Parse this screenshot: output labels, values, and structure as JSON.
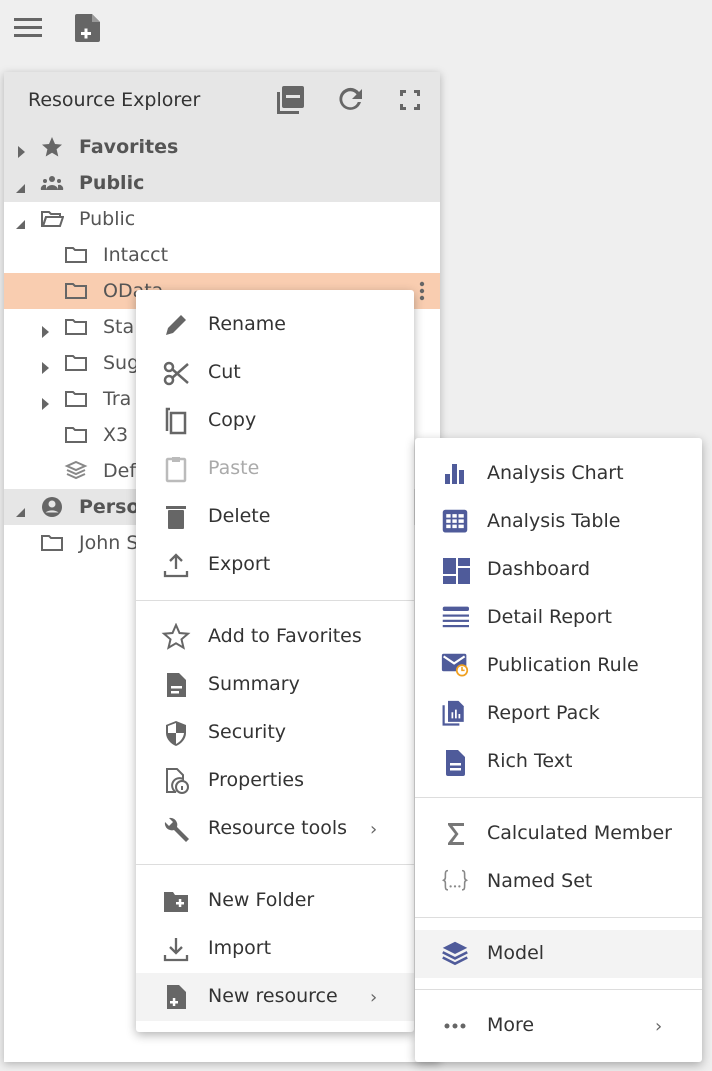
{
  "toolbar": {
    "menu_icon": "hamburger-icon",
    "new_resource_icon": "file-plus-icon"
  },
  "explorer": {
    "title": "Resource Explorer",
    "header_icons": [
      "collapse-all-icon",
      "refresh-icon",
      "fullscreen-icon"
    ],
    "tree": [
      {
        "label": "Favorites",
        "icon": "star-icon",
        "expander": "collapsed"
      },
      {
        "label": "Public",
        "icon": "group-icon",
        "expander": "expanded"
      },
      {
        "label": "Public",
        "icon": "folder-open-icon",
        "expander": "expanded"
      },
      {
        "label": "Intacct",
        "icon": "folder-icon"
      },
      {
        "label": "OData",
        "icon": "folder-icon",
        "selected": true
      },
      {
        "label": "Sta",
        "icon": "folder-icon",
        "expander": "collapsed"
      },
      {
        "label": "Sug",
        "icon": "folder-icon",
        "expander": "collapsed"
      },
      {
        "label": "Tra",
        "icon": "folder-icon",
        "expander": "collapsed"
      },
      {
        "label": "X3",
        "icon": "folder-icon"
      },
      {
        "label": "Def",
        "icon": "model-icon"
      },
      {
        "label": "Perso",
        "icon": "account-icon",
        "expander": "expanded"
      },
      {
        "label": "John S",
        "icon": "folder-icon"
      }
    ],
    "selected_color": "#f9cdb0"
  },
  "context_menu": {
    "groups": [
      [
        {
          "label": "Rename",
          "icon": "pencil-icon"
        },
        {
          "label": "Cut",
          "icon": "scissors-icon"
        },
        {
          "label": "Copy",
          "icon": "copy-icon"
        },
        {
          "label": "Paste",
          "icon": "clipboard-icon",
          "disabled": true
        },
        {
          "label": "Delete",
          "icon": "trash-icon"
        },
        {
          "label": "Export",
          "icon": "export-icon"
        }
      ],
      [
        {
          "label": "Add to Favorites",
          "icon": "star-outline-icon"
        },
        {
          "label": "Summary",
          "icon": "document-icon"
        },
        {
          "label": "Security",
          "icon": "shield-icon"
        },
        {
          "label": "Properties",
          "icon": "file-info-icon"
        },
        {
          "label": "Resource tools",
          "icon": "wrench-icon",
          "submenu": true
        }
      ],
      [
        {
          "label": "New Folder",
          "icon": "folder-plus-icon"
        },
        {
          "label": "Import",
          "icon": "import-icon"
        },
        {
          "label": "New resource",
          "icon": "file-plus-icon",
          "submenu": true,
          "active": true
        }
      ]
    ]
  },
  "submenu": {
    "accent": "#4f5b9a",
    "groups": [
      [
        {
          "label": "Analysis Chart",
          "icon": "bar-chart-icon"
        },
        {
          "label": "Analysis Table",
          "icon": "table-icon"
        },
        {
          "label": "Dashboard",
          "icon": "dashboard-icon"
        },
        {
          "label": "Detail Report",
          "icon": "list-report-icon"
        },
        {
          "label": "Publication Rule",
          "icon": "mail-clock-icon"
        },
        {
          "label": "Report Pack",
          "icon": "report-pack-icon"
        },
        {
          "label": "Rich Text",
          "icon": "rich-text-icon"
        }
      ],
      [
        {
          "label": "Calculated Member",
          "icon": "sigma-icon"
        },
        {
          "label": "Named Set",
          "icon": "braces-icon"
        }
      ],
      [
        {
          "label": "Model",
          "icon": "layers-icon",
          "active": true
        }
      ],
      [
        {
          "label": "More",
          "icon": "more-icon",
          "submenu": true
        }
      ]
    ]
  }
}
